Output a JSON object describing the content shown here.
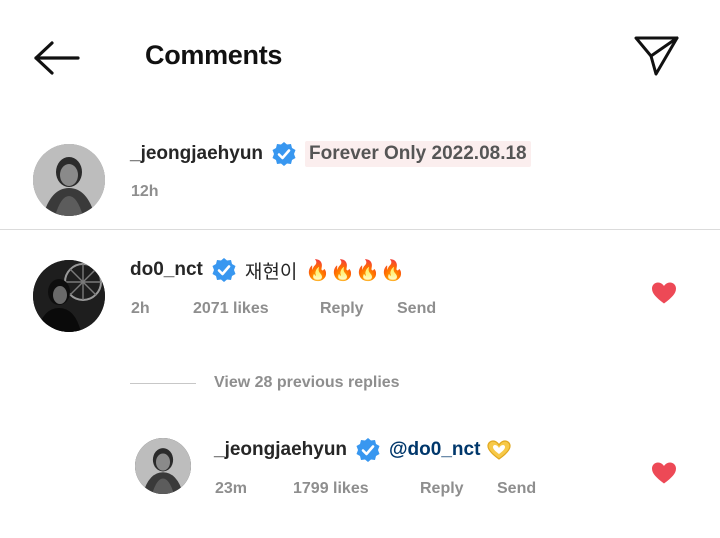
{
  "header": {
    "title": "Comments"
  },
  "caption": {
    "username": "_jeongjaehyun",
    "text": "Forever Only 2022.08.18",
    "time": "12h"
  },
  "comments": [
    {
      "username": "do0_nct",
      "text": "재현이",
      "emoji": "🔥🔥🔥🔥",
      "time": "2h",
      "likes": "2071 likes",
      "reply_label": "Reply",
      "send_label": "Send",
      "view_replies": "View 28 previous replies",
      "reply": {
        "username": "_jeongjaehyun",
        "mention": "@do0_nct",
        "time": "23m",
        "likes": "1799 likes",
        "reply_label": "Reply",
        "send_label": "Send"
      }
    }
  ],
  "colors": {
    "verified": "#3897f0",
    "heart": "#ed4956",
    "meta": "#8e8e8e",
    "mention": "#00376b",
    "caption_highlight": "#fbeeee"
  },
  "icons": {
    "back": "arrow-left-icon",
    "send": "paper-plane-icon",
    "verified": "verified-badge-icon",
    "like": "heart-icon"
  }
}
